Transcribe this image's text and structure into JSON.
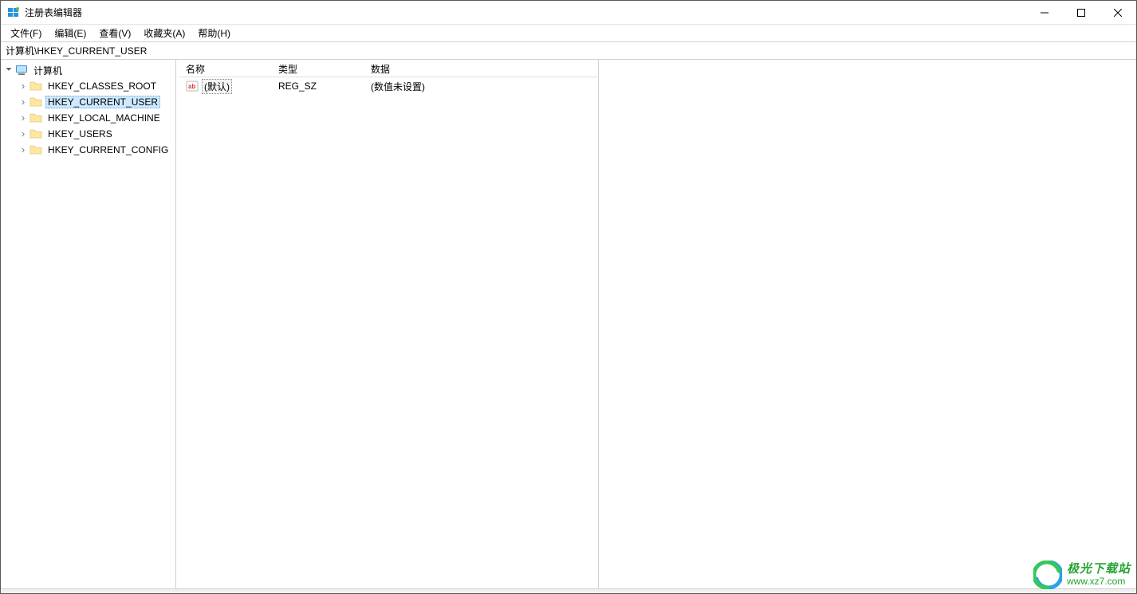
{
  "window": {
    "title": "注册表编辑器"
  },
  "menus": {
    "file": "文件(F)",
    "edit": "编辑(E)",
    "view": "查看(V)",
    "favorites": "收藏夹(A)",
    "help": "帮助(H)"
  },
  "path": "计算机\\HKEY_CURRENT_USER",
  "tree": {
    "root": "计算机",
    "items": [
      {
        "label": "HKEY_CLASSES_ROOT"
      },
      {
        "label": "HKEY_CURRENT_USER"
      },
      {
        "label": "HKEY_LOCAL_MACHINE"
      },
      {
        "label": "HKEY_USERS"
      },
      {
        "label": "HKEY_CURRENT_CONFIG"
      }
    ],
    "selected_index": 1
  },
  "list": {
    "headers": {
      "name": "名称",
      "type": "类型",
      "data": "数据"
    },
    "rows": [
      {
        "name": "(默认)",
        "type": "REG_SZ",
        "data": "(数值未设置)"
      }
    ]
  },
  "watermark": {
    "title": "极光下载站",
    "url": "www.xz7.com"
  }
}
